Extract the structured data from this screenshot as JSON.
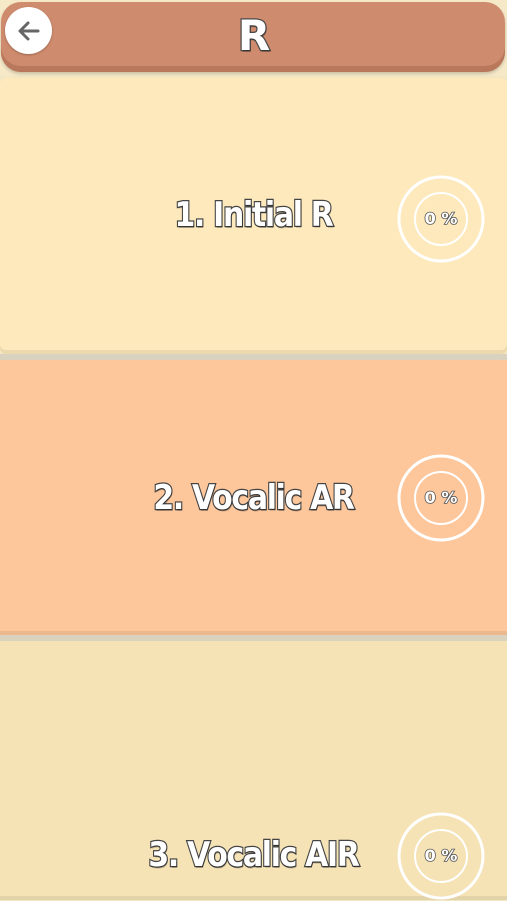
{
  "header": {
    "title": "R",
    "back_icon": "arrow-left-icon"
  },
  "colors": {
    "header_bar": "#cf8b6d",
    "card_1": "#fde9bb",
    "card_2": "#fdc69b",
    "card_3": "#f5e3b6",
    "ring": "#ffffff"
  },
  "lessons": [
    {
      "label": "1. Initial R",
      "progress": "0 %",
      "progress_value": 0
    },
    {
      "label": "2. Vocalic AR",
      "progress": "0 %",
      "progress_value": 0
    },
    {
      "label": "3. Vocalic AIR",
      "progress": "0 %",
      "progress_value": 0
    }
  ]
}
